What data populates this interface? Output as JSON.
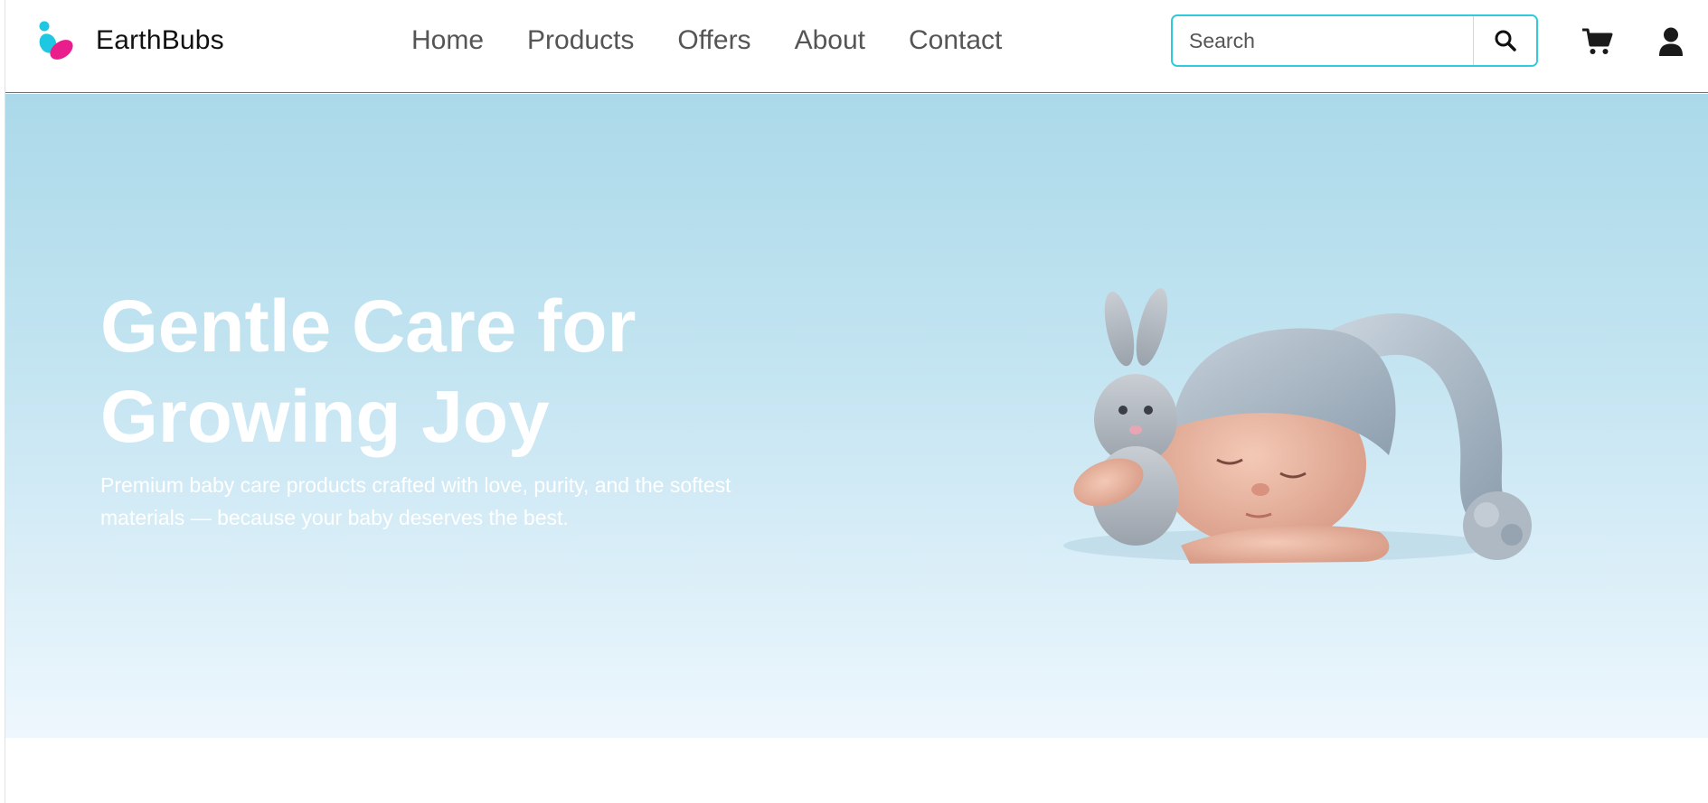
{
  "brand": {
    "name": "EarthBubs",
    "logo_icon": "butterfly-logo-icon",
    "logo_colors": [
      "#1ec8e3",
      "#e91e8c"
    ]
  },
  "nav": {
    "items": [
      {
        "label": "Home"
      },
      {
        "label": "Products"
      },
      {
        "label": "Offers"
      },
      {
        "label": "About"
      },
      {
        "label": "Contact"
      }
    ]
  },
  "search": {
    "placeholder": "Search",
    "value": "",
    "button_icon": "search-icon",
    "border_color": "#2fcbdc"
  },
  "actions": {
    "cart_icon": "cart-icon",
    "user_icon": "user-icon"
  },
  "hero": {
    "title_line1": "Gentle Care for",
    "title_line2": "Growing Joy",
    "subtitle_line1": "Premium baby care products crafted with love, purity, and the softest",
    "subtitle_line2": "materials — because your baby deserves the best.",
    "image": "sleeping-baby-with-knit-hat-and-bunny-image",
    "background_top": "#abd9e9",
    "background_bottom": "#eef7fd"
  }
}
